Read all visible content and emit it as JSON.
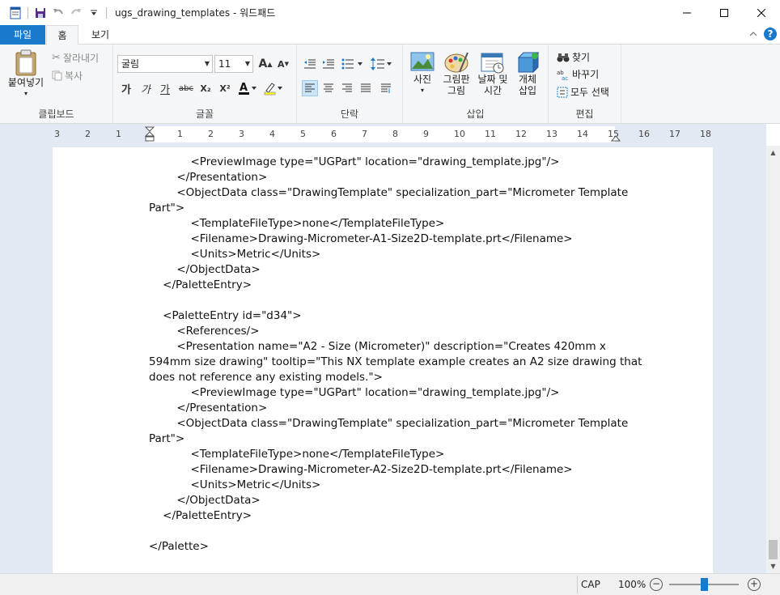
{
  "window": {
    "title": "ugs_drawing_templates - 워드패드",
    "minimize": "—",
    "maximize": "☐",
    "close": "✕"
  },
  "tabs": {
    "file": "파일",
    "home": "홈",
    "view": "보기",
    "collapse": "^",
    "help": "?"
  },
  "clipboard": {
    "paste": "붙여넣기",
    "cut": "잘라내기",
    "copy": "복사",
    "group_label": "클립보드"
  },
  "font": {
    "family": "굴림",
    "size": "11",
    "grow": "A",
    "shrink": "A",
    "bold": "가",
    "italic": "가",
    "underline": "가",
    "strikethrough": "abc",
    "subscript": "X₂",
    "superscript": "X²",
    "group_label": "글꼴"
  },
  "paragraph": {
    "group_label": "단락"
  },
  "insert": {
    "picture_line1": "사진",
    "paint_line1": "그림판",
    "paint_line2": "그림",
    "datetime_line1": "날짜 및",
    "datetime_line2": "시간",
    "object_line1": "개체",
    "object_line2": "삽입",
    "group_label": "삽입"
  },
  "editing": {
    "find": "찾기",
    "replace": "바꾸기",
    "select_all": "모두 선택",
    "group_label": "편집"
  },
  "ruler": {
    "labels": [
      "3",
      "2",
      "1",
      "1",
      "2",
      "3",
      "4",
      "5",
      "6",
      "7",
      "8",
      "9",
      "10",
      "11",
      "12",
      "13",
      "14",
      "15",
      "16",
      "17",
      "18"
    ]
  },
  "document": {
    "lines": [
      "            <PreviewImage type=\"UGPart\" location=\"drawing_template.jpg\"/>",
      "        </Presentation>",
      "        <ObjectData class=\"DrawingTemplate\" specialization_part=\"Micrometer Template",
      "Part\">",
      "            <TemplateFileType>none</TemplateFileType>",
      "            <Filename>Drawing-Micrometer-A1-Size2D-template.prt</Filename>",
      "            <Units>Metric</Units>",
      "        </ObjectData>",
      "    </PaletteEntry>",
      "",
      "    <PaletteEntry id=\"d34\">",
      "        <References/>",
      "        <Presentation name=\"A2 - Size (Micrometer)\" description=\"Creates 420mm x",
      "594mm size drawing\" tooltip=\"This NX template example creates an A2 size drawing that",
      "does not reference any existing models.\">",
      "            <PreviewImage type=\"UGPart\" location=\"drawing_template.jpg\"/>",
      "        </Presentation>",
      "        <ObjectData class=\"DrawingTemplate\" specialization_part=\"Micrometer Template",
      "Part\">",
      "            <TemplateFileType>none</TemplateFileType>",
      "            <Filename>Drawing-Micrometer-A2-Size2D-template.prt</Filename>",
      "            <Units>Metric</Units>",
      "        </ObjectData>",
      "    </PaletteEntry>",
      "",
      "</Palette>"
    ]
  },
  "status": {
    "caps": "CAP",
    "zoom": "100%",
    "zoom_out": "−",
    "zoom_in": "+"
  },
  "colors": {
    "accent": "#1979ca",
    "ribbon_bg": "#f5f6f7",
    "doc_bg": "#e3e9f2"
  }
}
